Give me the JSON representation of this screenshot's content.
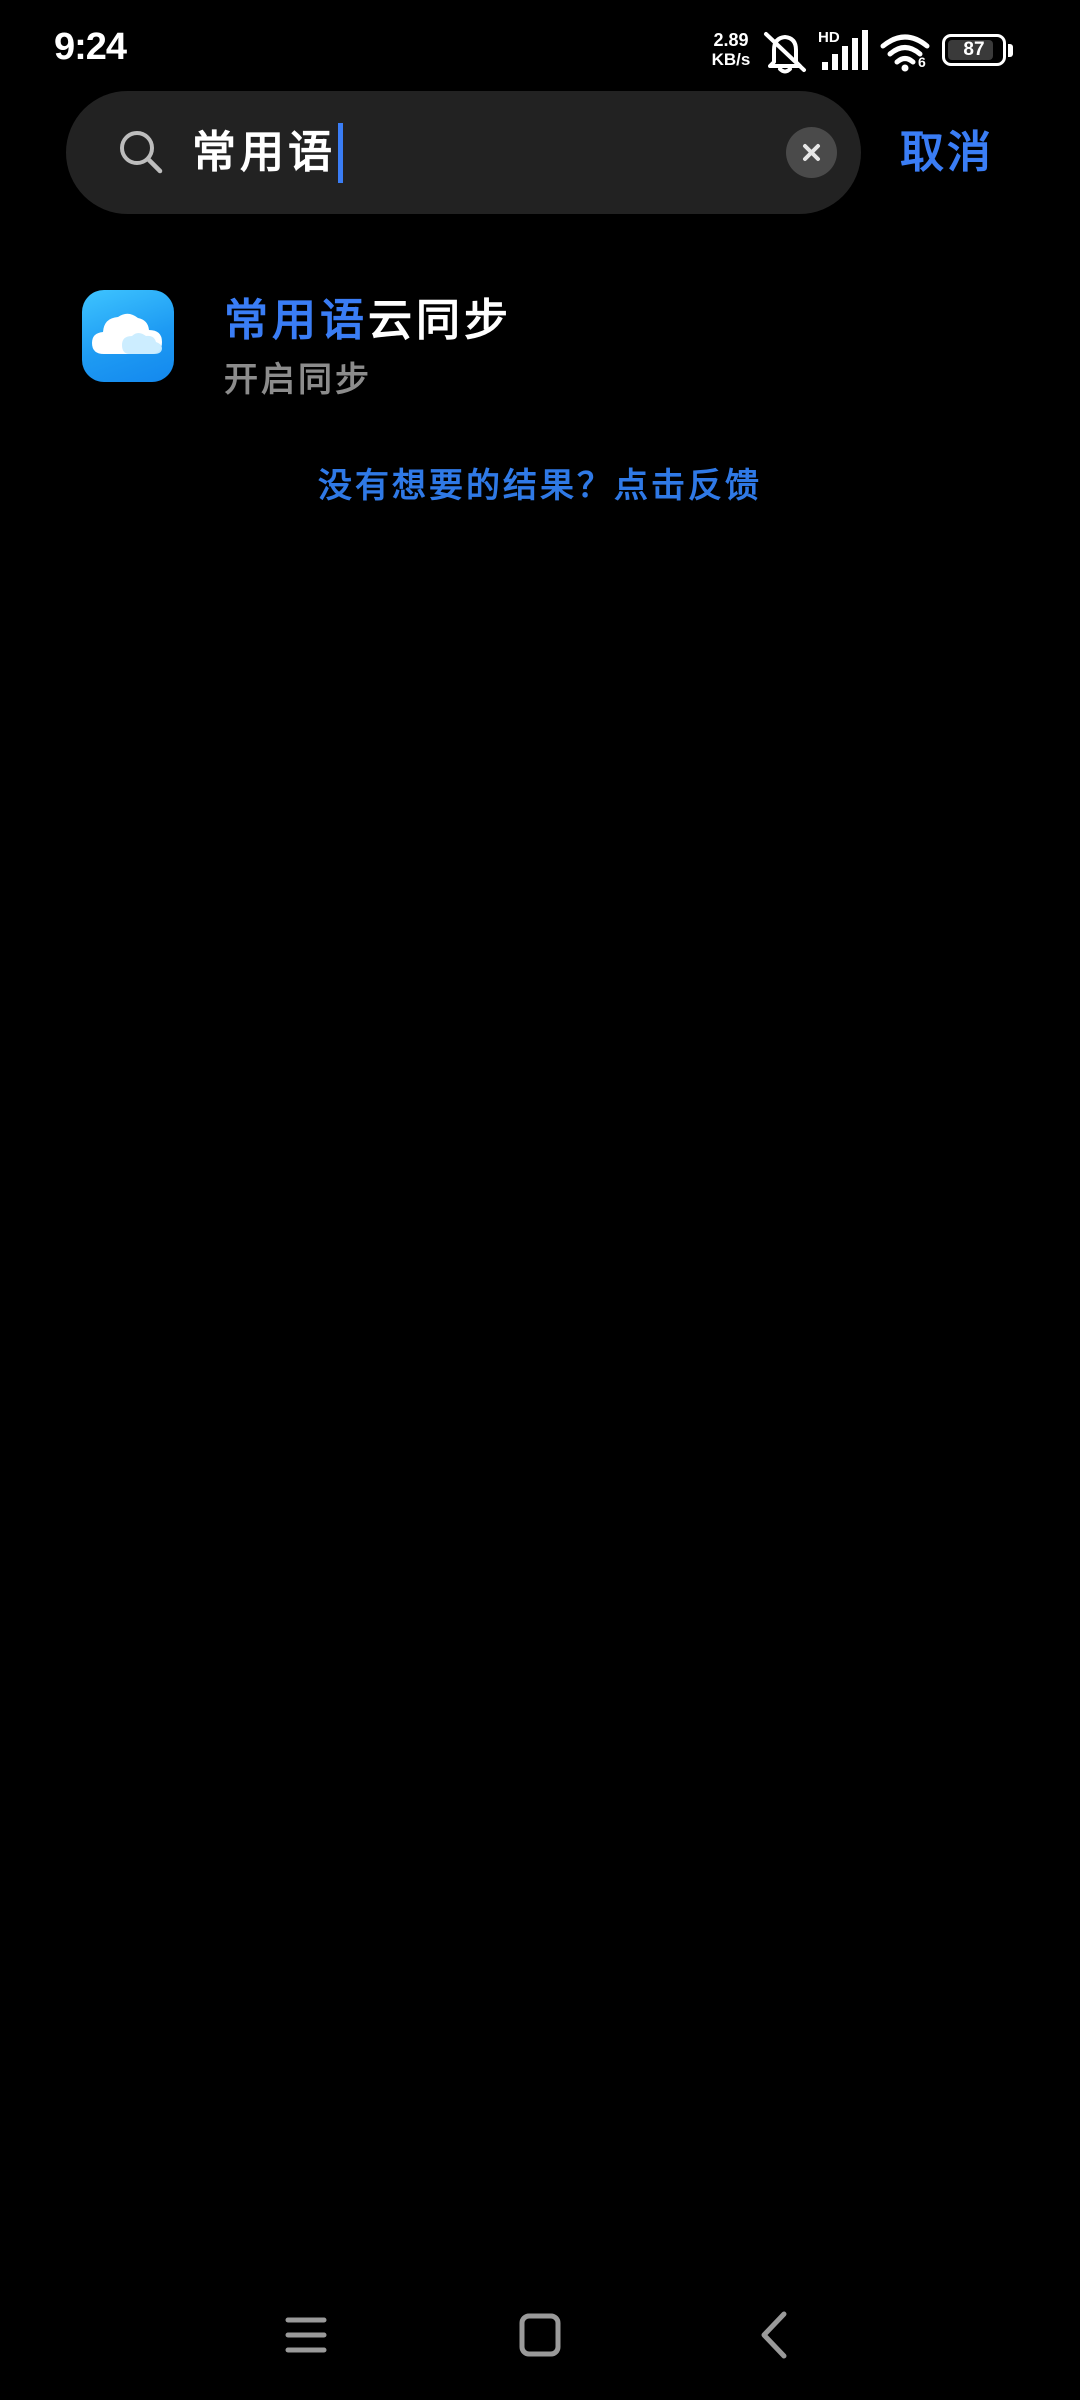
{
  "status_bar": {
    "time": "9:24",
    "net_speed_value": "2.89",
    "net_speed_unit": "KB/s",
    "hd_label": "HD",
    "wifi_label": "6",
    "battery_level": "87",
    "battery_fraction": 0.87,
    "icons": [
      "mute-bell-icon",
      "cellular-signal-icon",
      "wifi-icon",
      "battery-icon"
    ]
  },
  "search": {
    "query": "常用语",
    "icon": "search-icon",
    "clear_icon": "close-icon",
    "cancel_label": "取消"
  },
  "results": [
    {
      "icon": "cloud-icon",
      "title_highlight": "常用语",
      "title_rest": "云同步",
      "subtitle": "开启同步"
    }
  ],
  "feedback": {
    "label": "没有想要的结果？点击反馈"
  },
  "nav_bar": {
    "buttons": [
      "menu-icon",
      "home-icon",
      "back-icon"
    ]
  },
  "colors": {
    "accent": "#3a7df5",
    "background": "#000000",
    "search_bg": "#222222",
    "subtitle": "#8c8c8c"
  }
}
